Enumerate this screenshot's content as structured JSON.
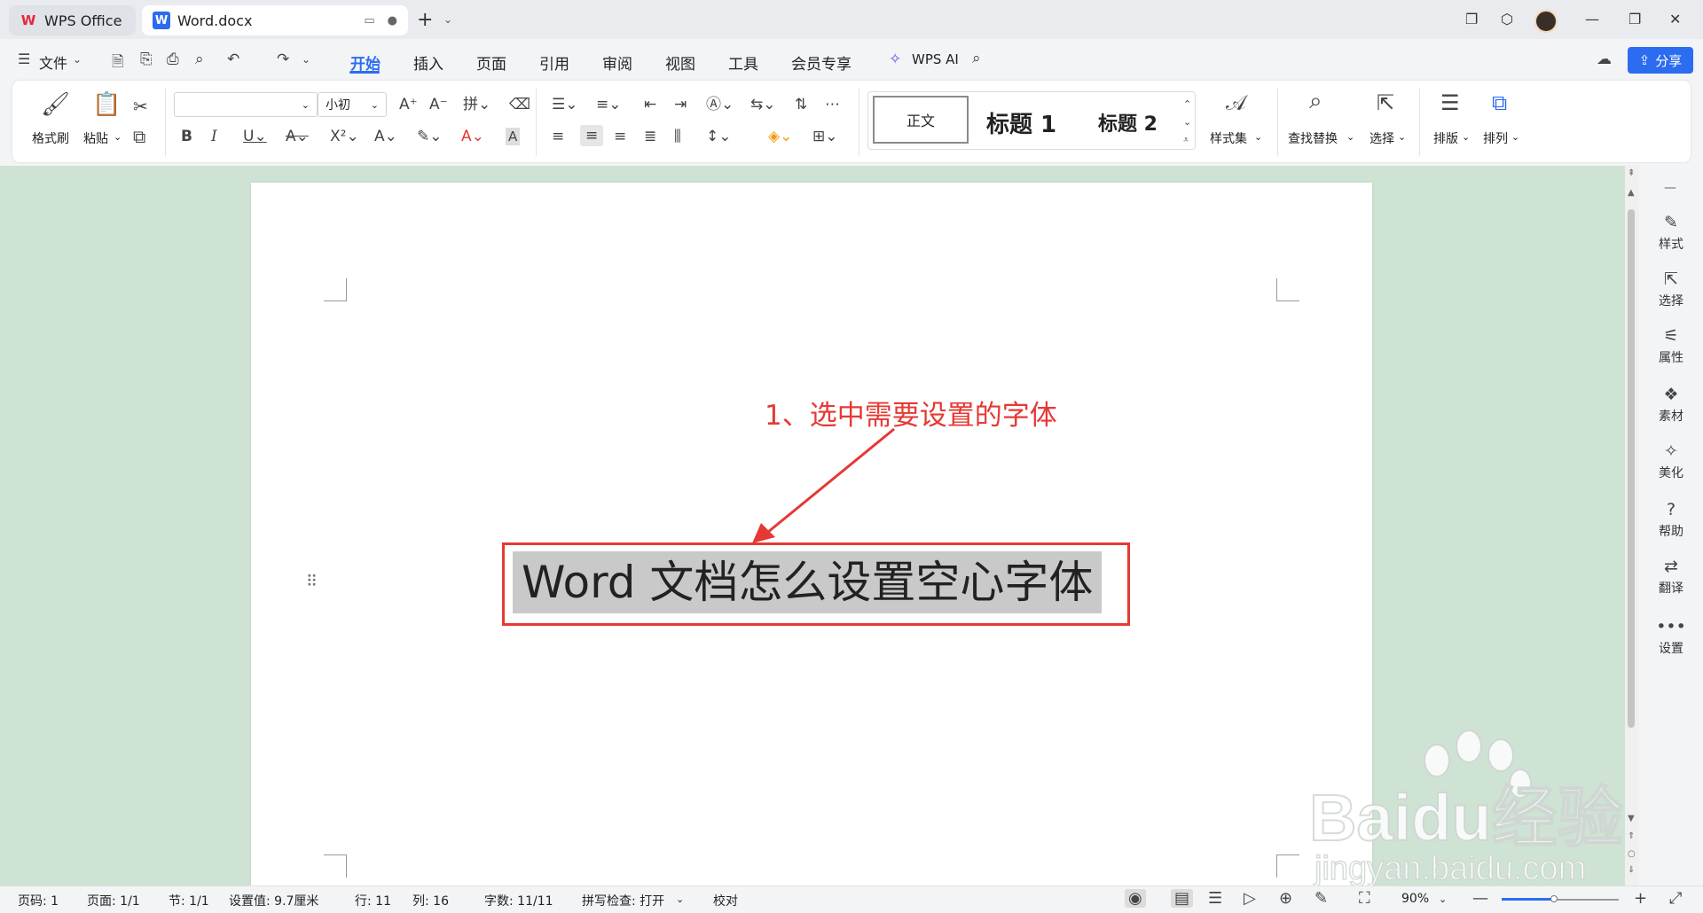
{
  "tabs": {
    "wps_label": "WPS Office",
    "doc_label": "Word.docx"
  },
  "menu": {
    "file": "文件",
    "items": [
      "开始",
      "插入",
      "页面",
      "引用",
      "审阅",
      "视图",
      "工具",
      "会员专享"
    ],
    "wps_ai": "WPS AI",
    "share": "分享"
  },
  "ribbon": {
    "format_painter": "格式刷",
    "paste": "粘贴",
    "font_name": "",
    "font_size": "小初",
    "styles": {
      "normal": "正文",
      "h1": "标题 1",
      "h2": "标题 2"
    },
    "style_set": "样式集",
    "find_replace": "查找替换",
    "select": "选择",
    "layout": "排版",
    "arrange": "排列"
  },
  "document": {
    "annotation": "1、选中需要设置的字体",
    "text": "Word 文档怎么设置空心字体"
  },
  "right_panel": [
    "样式",
    "选择",
    "属性",
    "素材",
    "美化",
    "帮助",
    "翻译",
    "设置"
  ],
  "status": {
    "page_num": "页码: 1",
    "page": "页面: 1/1",
    "section": "节: 1/1",
    "setting": "设置值: 9.7厘米",
    "row": "行: 11",
    "col": "列: 16",
    "words": "字数: 11/11",
    "spell": "拼写检查: 打开",
    "proof": "校对",
    "zoom": "90%",
    "zoom_level": 0.45
  },
  "watermark": {
    "brand": "Baidu经验",
    "url": "jingyan.baidu.com"
  },
  "colors": {
    "accent": "#2b6cf0",
    "annotation": "#e53935",
    "canvas": "#cfe3d4"
  }
}
